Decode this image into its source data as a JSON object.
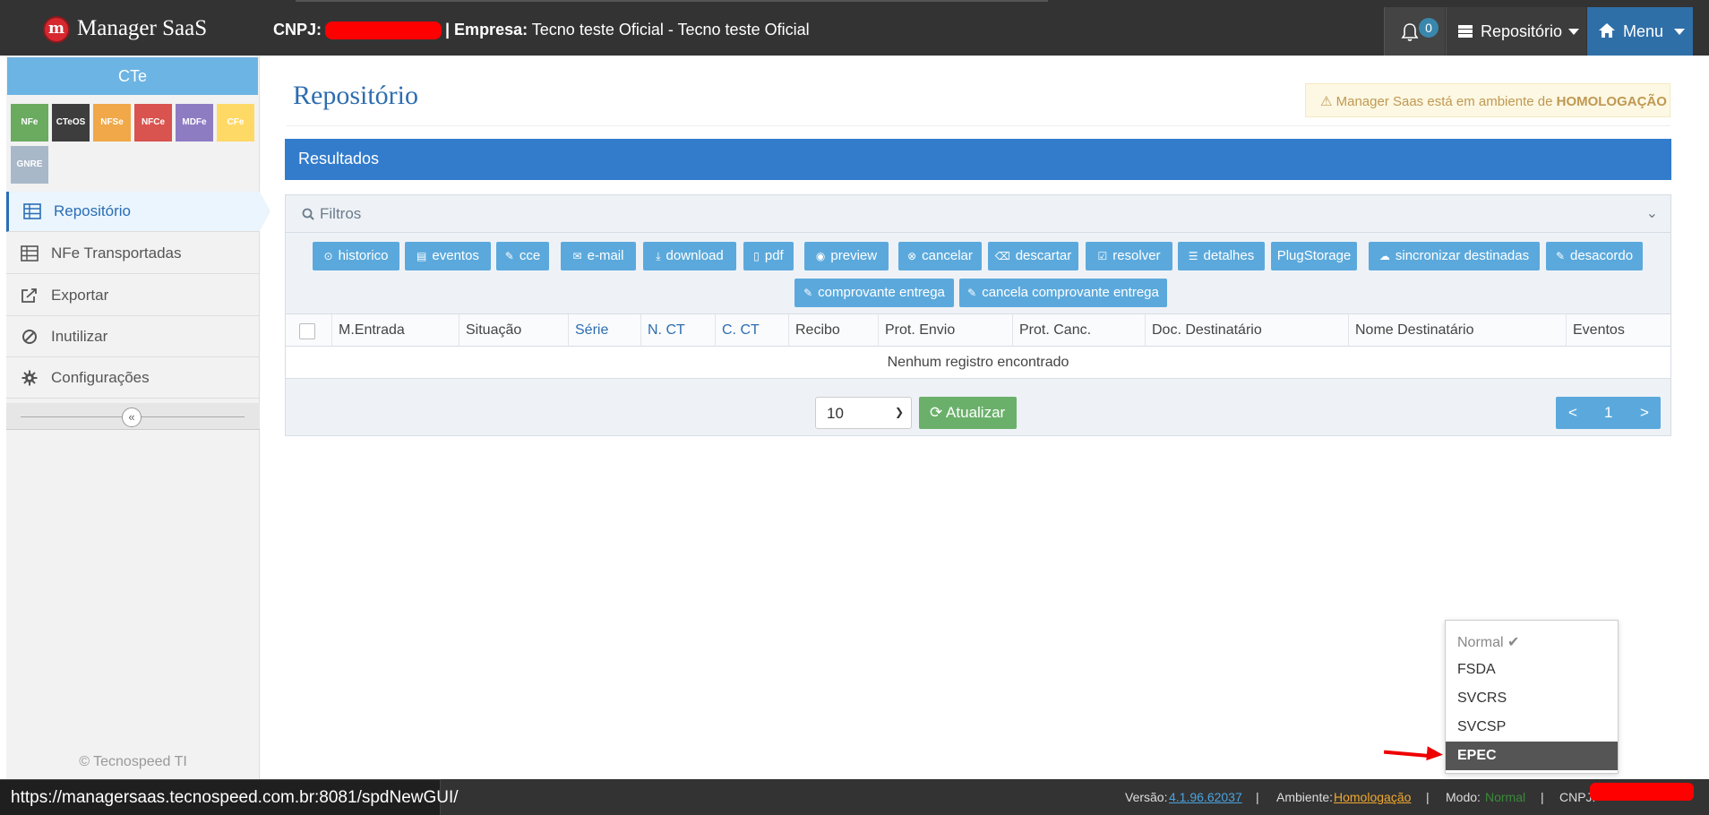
{
  "header": {
    "brand": "Manager SaaS",
    "logo_letter": "m",
    "cnpj_label": "CNPJ:",
    "empresa_label": "| Empresa:",
    "empresa_value": "Tecno teste Oficial - Tecno teste Oficial",
    "notifications_count": "0",
    "repositorio_label": "Repositório",
    "menu_label": "Menu"
  },
  "sidebar": {
    "section_title": "CTe",
    "tiles": [
      {
        "label": "NFe",
        "color": "#6aab60"
      },
      {
        "label": "CTeOS",
        "color": "#3d3d3d"
      },
      {
        "label": "NFSe",
        "color": "#f0a848"
      },
      {
        "label": "NFCe",
        "color": "#d9534f"
      },
      {
        "label": "MDFe",
        "color": "#8e7cc3"
      },
      {
        "label": "CFe",
        "color": "#ffd966"
      },
      {
        "label": "GNRE",
        "color": "#a9b8c8"
      }
    ],
    "items": [
      {
        "label": "Repositório",
        "icon": "table-icon"
      },
      {
        "label": "NFe Transportadas",
        "icon": "table-icon"
      },
      {
        "label": "Exportar",
        "icon": "export-icon"
      },
      {
        "label": "Inutilizar",
        "icon": "ban-icon"
      },
      {
        "label": "Configurações",
        "icon": "gear-icon"
      }
    ],
    "collapse_glyph": "«",
    "copyright": "© Tecnospeed TI"
  },
  "main": {
    "title": "Repositório",
    "alert_text": "Manager Saas está em ambiente de",
    "alert_strong": "HOMOLOGAÇÃO",
    "results_title": "Resultados",
    "filters_label": "Filtros",
    "actions": [
      {
        "label": "historico",
        "icon": "⊙"
      },
      {
        "label": "eventos",
        "icon": "▤"
      },
      {
        "label": "cce",
        "icon": "✎"
      },
      {
        "label": "e-mail",
        "icon": "✉"
      },
      {
        "label": "download",
        "icon": "⤓"
      },
      {
        "label": "pdf",
        "icon": "▯"
      },
      {
        "label": "preview",
        "icon": "◉"
      },
      {
        "label": "cancelar",
        "icon": "⊗"
      },
      {
        "label": "descartar",
        "icon": "⌫"
      },
      {
        "label": "resolver",
        "icon": "☑"
      },
      {
        "label": "detalhes",
        "icon": "☰"
      },
      {
        "label": "PlugStorage",
        "icon": ""
      },
      {
        "label": "sincronizar destinadas",
        "icon": "☁"
      },
      {
        "label": "desacordo",
        "icon": "✎"
      },
      {
        "label": "comprovante entrega",
        "icon": "✎"
      },
      {
        "label": "cancela comprovante entrega",
        "icon": "✎"
      }
    ],
    "columns": [
      "M.Entrada",
      "Situação",
      "Série",
      "N. CT",
      "C. CT",
      "Recibo",
      "Prot. Envio",
      "Prot. Canc.",
      "Doc. Destinatário",
      "Nome Destinatário",
      "Eventos"
    ],
    "empty_message": "Nenhum registro encontrado",
    "page_size": "10",
    "refresh_label": "Atualizar",
    "pager": {
      "prev": "<",
      "current": "1",
      "next": ">"
    }
  },
  "mode_menu": {
    "items": [
      "Normal ✔",
      "FSDA",
      "SVCRS",
      "SVCSP",
      "EPEC"
    ],
    "selected": "EPEC"
  },
  "footer": {
    "versao_label": "Versão:",
    "versao_value": "4.1.96.62037",
    "sep": "|",
    "ambiente_label": "Ambiente:",
    "ambiente_value": "Homologação",
    "modo_label": "Modo:",
    "modo_value": "Normal",
    "cnpj_label": "CNPJ:",
    "status_url": "https://managersaas.tecnospeed.com.br:8081/spdNewGUI/"
  }
}
